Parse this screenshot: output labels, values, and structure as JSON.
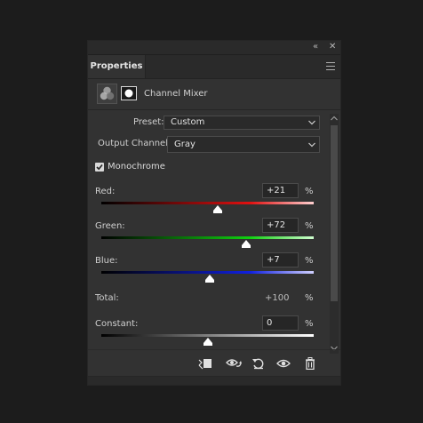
{
  "panel": {
    "collapse_glyph": "«",
    "close_glyph": "✕",
    "tab_label": "Properties",
    "header_title": "Channel Mixer"
  },
  "preset": {
    "label": "Preset:",
    "value": "Custom"
  },
  "output_channel": {
    "label": "Output Channel:",
    "value": "Gray"
  },
  "monochrome": {
    "label": "Monochrome",
    "checked": true
  },
  "channels": {
    "red": {
      "label": "Red:",
      "value": "+21",
      "unit": "%",
      "slider_fraction": 0.55,
      "gradient_end": "#ff0000"
    },
    "green": {
      "label": "Green:",
      "value": "+72",
      "unit": "%",
      "slider_fraction": 0.68,
      "gradient_end": "#00ff00"
    },
    "blue": {
      "label": "Blue:",
      "value": "+7",
      "unit": "%",
      "slider_fraction": 0.51,
      "gradient_end": "#0000ff"
    }
  },
  "total": {
    "label": "Total:",
    "value": "+100",
    "unit": "%"
  },
  "constant": {
    "label": "Constant:",
    "value": "0",
    "unit": "%",
    "slider_fraction": 0.5
  },
  "footer_icons": [
    "clip-to-layer-icon",
    "view-previous-state-icon",
    "reset-icon",
    "visibility-icon",
    "delete-icon"
  ]
}
